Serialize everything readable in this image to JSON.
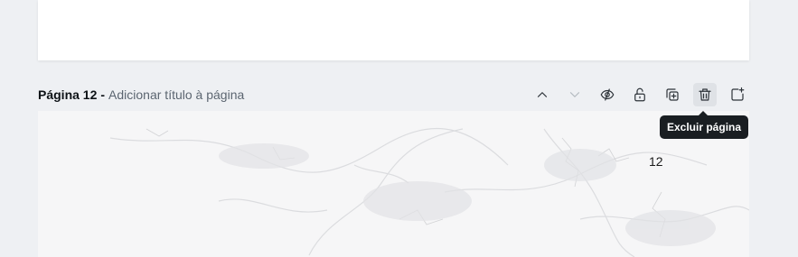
{
  "page": {
    "label": "Página 12",
    "separator": "-",
    "add_title": "Adicionar título à página"
  },
  "toolbar": {
    "items": [
      {
        "name": "move-up",
        "icon": "chevron-up-icon"
      },
      {
        "name": "move-down",
        "icon": "chevron-down-icon",
        "disabled": true
      },
      {
        "name": "hide-page",
        "icon": "eye-slash-icon"
      },
      {
        "name": "lock-page",
        "icon": "unlock-icon"
      },
      {
        "name": "duplicate-page",
        "icon": "duplicate-icon"
      },
      {
        "name": "delete-page",
        "icon": "trash-icon",
        "active": true
      },
      {
        "name": "add-page",
        "icon": "add-page-icon"
      }
    ]
  },
  "tooltip": {
    "text": "Excluir página"
  },
  "canvas": {
    "page_number": "12"
  }
}
